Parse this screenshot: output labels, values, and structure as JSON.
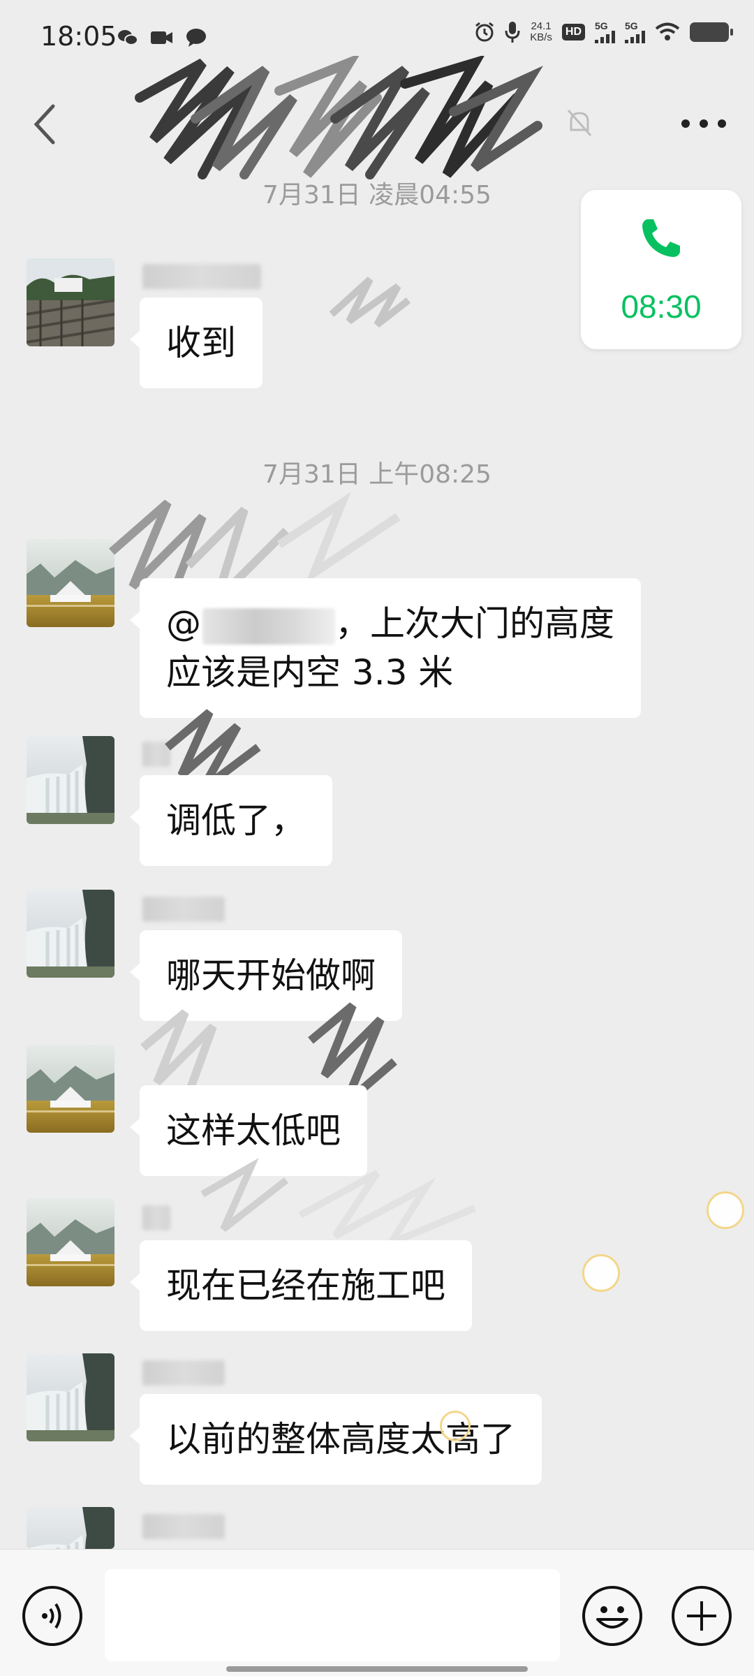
{
  "status_bar": {
    "time": "18:05",
    "net_speed_value": "24.1",
    "net_speed_unit": "KB/s",
    "hd_badge": "HD",
    "sim1_label": "5G",
    "sim2_label": "5G"
  },
  "call_widget": {
    "duration": "08:30",
    "icon": "phone-icon",
    "accent_color": "#07c160"
  },
  "messages": {
    "ts1": "7月31日 凌晨04:55",
    "ts2": "7月31日 上午08:25",
    "m1": "收到",
    "m2_prefix": "@",
    "m2_text": "，上次大门的高度\n应该是内空 3.3 米",
    "m3": "调低了，",
    "m4": "哪天开始做啊",
    "m5": "这样太低吧",
    "m6": "现在已经在施工吧",
    "m7": "以前的整体高度太高了"
  },
  "input_bar": {
    "voice_icon": "voice-icon",
    "emoji_icon": "emoji-icon",
    "plus_icon": "plus-icon"
  }
}
